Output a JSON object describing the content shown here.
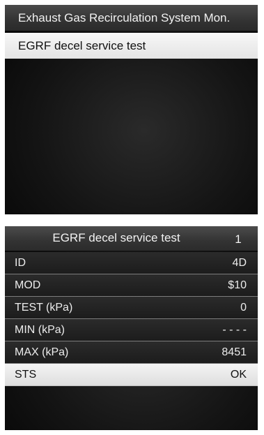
{
  "screen1": {
    "title": "Exhaust Gas Recirculation System Mon.",
    "selected_item": "EGRF decel service test"
  },
  "screen2": {
    "title": "EGRF decel service test",
    "page_number": "1",
    "rows": [
      {
        "label": "ID",
        "value": "4D"
      },
      {
        "label": "MOD",
        "value": "$10"
      },
      {
        "label": "TEST (kPa)",
        "value": "0"
      },
      {
        "label": "MIN (kPa)",
        "value": "- - - -"
      },
      {
        "label": "MAX (kPa)",
        "value": "8451"
      },
      {
        "label": "STS",
        "value": "OK"
      }
    ]
  }
}
